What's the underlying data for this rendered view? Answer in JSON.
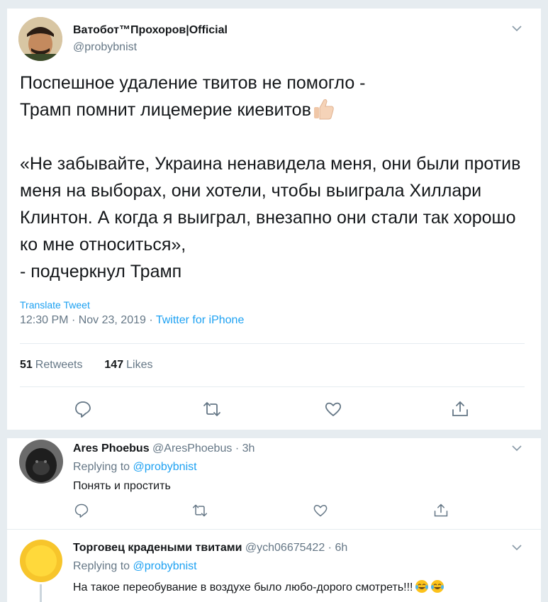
{
  "tweet": {
    "display_name": "Ватобот™Прохоров|Official",
    "handle": "@probybnist",
    "text": "Поспешное удаление твитов не помогло -\nТрамп помнит лицемерие киевитов",
    "quote": "«Не забывайте, Украина ненавидела меня, они были против меня на выборах, они хотели, чтобы выиграла Хиллари Клинтон. А когда я выиграл, внезапно они стали так хорошо ко мне относиться»,\n- подчеркнул Трамп",
    "translate_label": "Translate Tweet",
    "time": "12:30 PM",
    "date": "Nov 23, 2019",
    "source": "Twitter for iPhone",
    "retweets_count": "51",
    "retweets_label": "Retweets",
    "likes_count": "147",
    "likes_label": "Likes",
    "emoji": "thumbs-up"
  },
  "replies": [
    {
      "name": "Ares Phoebus",
      "handle": "@AresPhoebus",
      "age": "3h",
      "replying_prefix": "Replying to",
      "replying_to": "@probybnist",
      "text": "Понять и простить"
    },
    {
      "name": "Торговец крадеными твитами",
      "handle": "@ych06675422",
      "age": "6h",
      "replying_prefix": "Replying to",
      "replying_to": "@probybnist",
      "text": "На такое переобувание  в воздухе было любо-дорого смотреть!!!",
      "emoji": "tears-of-joy"
    }
  ],
  "colors": {
    "accent": "#1da1f2",
    "secondary_text": "#657786",
    "divider": "#e6ecf0"
  }
}
